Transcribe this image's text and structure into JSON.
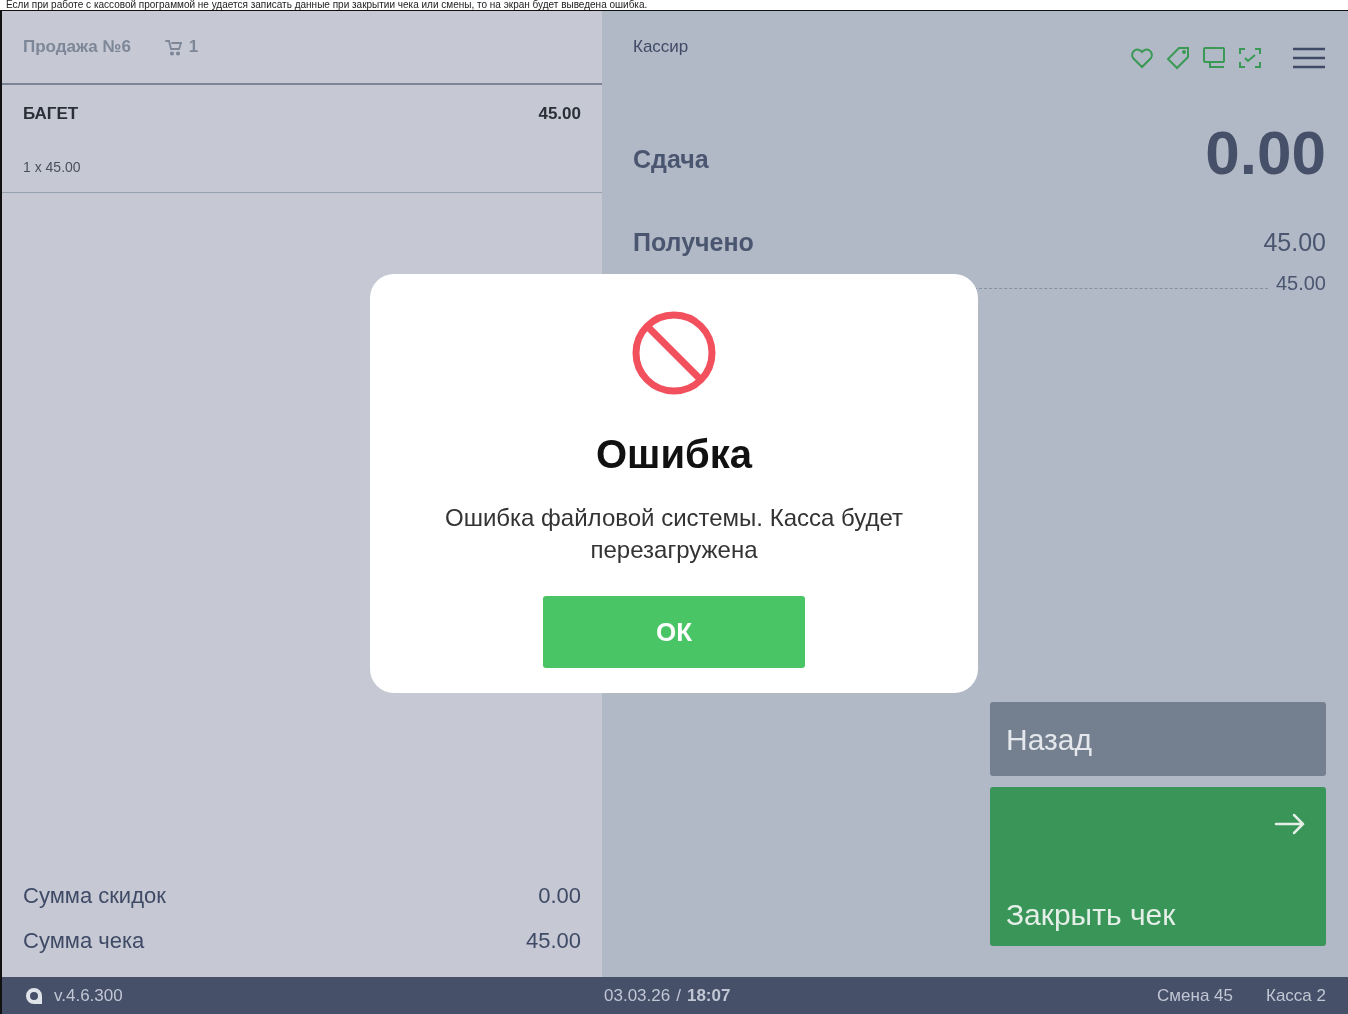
{
  "caption": "Если при работе с кассовой программой не удается записать данные при закрытии чека или смены, то на экран будет выведена ошибка.",
  "sale": {
    "title": "Продажа №6",
    "cart_count": "1"
  },
  "items": [
    {
      "name": "БАГЕТ",
      "total": "45.00",
      "detail": "1 x 45.00"
    }
  ],
  "totals": [
    {
      "label": "Сумма скидок",
      "value": "0.00"
    },
    {
      "label": "Сумма чека",
      "value": "45.00"
    }
  ],
  "cashier": "Кассир",
  "change": {
    "label": "Сдача",
    "value": "0.00"
  },
  "received": {
    "label": "Получено",
    "value": "45.00",
    "sub_value": "45.00"
  },
  "buttons": [
    {
      "kind": "back",
      "label": "Назад"
    },
    {
      "kind": "close",
      "label": "Закрыть чек"
    }
  ],
  "dialog": {
    "title": "Ошибка",
    "message": "Ошибка файловой системы. Касса будет перезагружена",
    "button": "ОК"
  },
  "status_bar": {
    "version": "v.4.6.300",
    "date": "03.03.26",
    "separator": "/",
    "time": "18:07",
    "shift": "Смена 45",
    "register": "Касса 2"
  }
}
